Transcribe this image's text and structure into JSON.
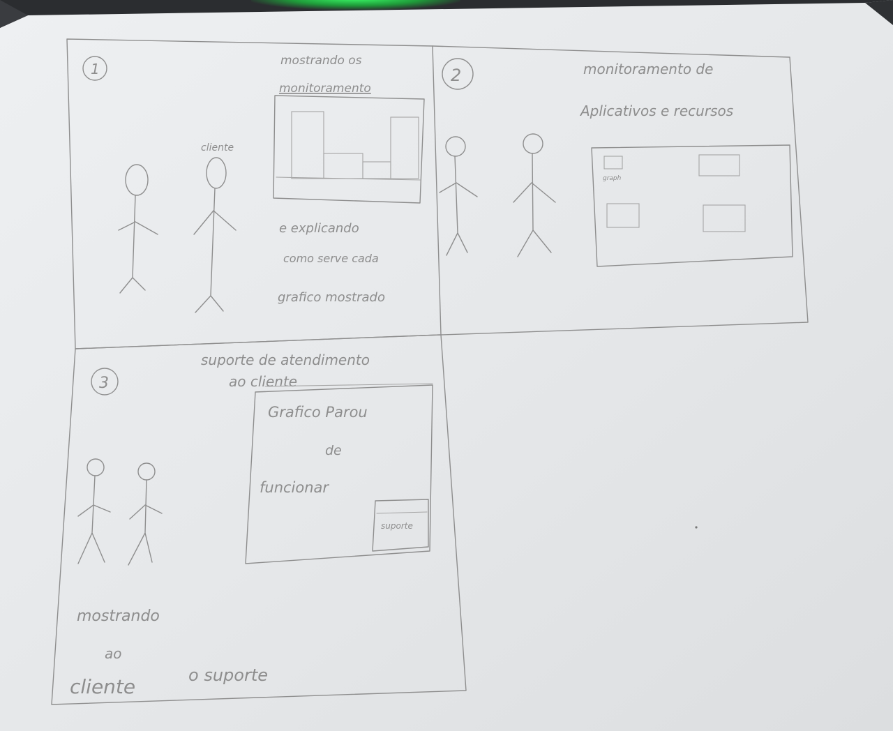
{
  "sketch": {
    "panel1": {
      "number": "1",
      "caption_top_1": "mostrando os",
      "caption_top_2": "monitoramento",
      "figure_label": "cliente",
      "caption_bottom_1": "e explicando",
      "caption_bottom_2": "como serve cada",
      "caption_bottom_3": "grafico mostrado"
    },
    "panel2": {
      "number": "2",
      "caption_1": "monitoramento de",
      "caption_2": "Aplicativos e recursos",
      "widget_label": "graph"
    },
    "panel3": {
      "number": "3",
      "caption_1": "suporte de atendimento",
      "caption_2": "ao cliente",
      "screen_line_1": "Grafico Parou",
      "screen_line_2": "de",
      "screen_line_3": "funcionar",
      "support_button": "suporte",
      "caption_bottom_1": "mostrando",
      "caption_bottom_2": "ao",
      "caption_bottom_3": "cliente",
      "caption_bottom_4": "o suporte"
    }
  }
}
